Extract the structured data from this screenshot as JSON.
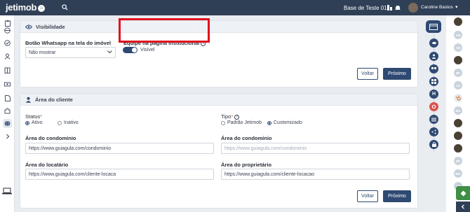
{
  "topbar": {
    "logo": "jetimob",
    "site_name": "Base de Teste 01",
    "user_name": "Caroline Bastos"
  },
  "visibility": {
    "title": "Visibilidade",
    "whatsapp_label": "Botão Whatsapp na tela do imóvel",
    "whatsapp_value": "Não mostrar",
    "team_label": "Equipe na página institucional",
    "team_toggle_label": "Visível",
    "team_toggle_on": true,
    "back_label": "Voltar",
    "next_label": "Próximo"
  },
  "client_area": {
    "title": "Área do cliente",
    "status_label": "Status",
    "status_options": [
      "Ativo",
      "Inativo"
    ],
    "status_selected": "Ativo",
    "type_label": "Tipo",
    "type_options": [
      "Padrão Jetimob",
      "Customizado"
    ],
    "type_selected": "Customizado",
    "condo_area_label": "Área do condomínio",
    "condo_area_value": "https://www.guiagula.com/condominio",
    "condo_area_label_2": "Área do condomínio",
    "condo_area_placeholder_2": "https://www.guiagula.com/condominio",
    "tenant_area_label": "Área do locatário",
    "tenant_area_value": "https://www.guiagula.com/cliente-locaca",
    "owner_area_label": "Área do proprietário",
    "owner_area_value": "https://www.guiagula.com/cliente-locacao",
    "back_label": "Voltar",
    "next_label": "Próximo"
  },
  "right_rail": {
    "avatar_initials": [
      "AM",
      "AM",
      "BF",
      "CS",
      "MA",
      "MT",
      "MG",
      "OS"
    ]
  },
  "colors": {
    "topbar": "#2f3f56",
    "primary": "#2f4a72",
    "highlight": "#e0121e"
  }
}
